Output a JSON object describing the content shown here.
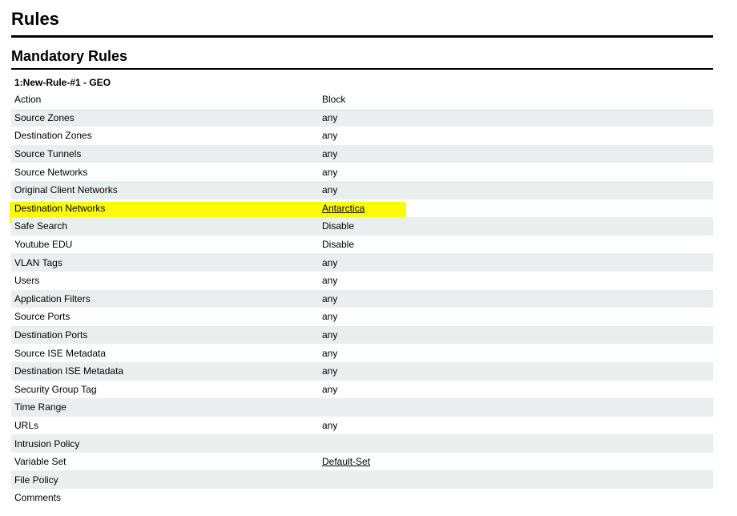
{
  "page_title": "Rules",
  "section_title": "Mandatory Rules",
  "rule_name": "1:New-Rule-#1 - GEO",
  "highlight_color": "#fbfb09",
  "rows": [
    {
      "key": "Action",
      "value": "Block"
    },
    {
      "key": "Source Zones",
      "value": "any"
    },
    {
      "key": "Destination Zones",
      "value": "any"
    },
    {
      "key": "Source Tunnels",
      "value": "any"
    },
    {
      "key": "Source Networks",
      "value": "any"
    },
    {
      "key": "Original Client Networks",
      "value": "any"
    },
    {
      "key": "Destination Networks",
      "value": "Antarctica"
    },
    {
      "key": "Safe Search",
      "value": "Disable"
    },
    {
      "key": "Youtube EDU",
      "value": "Disable"
    },
    {
      "key": "VLAN Tags",
      "value": "any"
    },
    {
      "key": "Users",
      "value": "any"
    },
    {
      "key": "Application Filters",
      "value": "any"
    },
    {
      "key": "Source Ports",
      "value": "any"
    },
    {
      "key": "Destination Ports",
      "value": "any"
    },
    {
      "key": "Source ISE Metadata",
      "value": "any"
    },
    {
      "key": "Destination ISE Metadata",
      "value": "any"
    },
    {
      "key": "Security Group Tag",
      "value": "any"
    },
    {
      "key": "Time Range",
      "value": ""
    },
    {
      "key": "URLs",
      "value": "any"
    },
    {
      "key": "Intrusion Policy",
      "value": ""
    },
    {
      "key": "Variable Set",
      "value": "Default-Set"
    },
    {
      "key": "File Policy",
      "value": ""
    },
    {
      "key": "Comments",
      "value": ""
    }
  ]
}
